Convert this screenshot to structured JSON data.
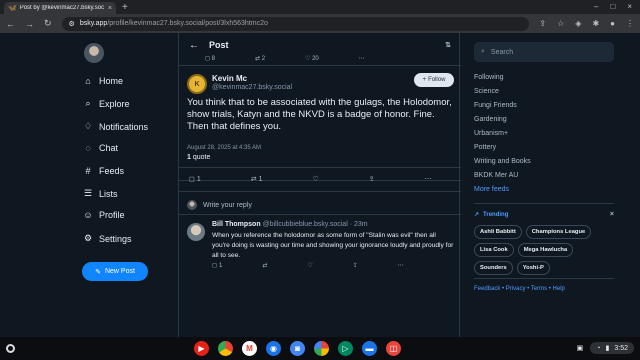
{
  "browser": {
    "tab_title": "Post by @kevinmac27.bsky.soc",
    "url_prefix": "bsky.app",
    "url_path": "/profile/kevinmac27.bsky.social/post/3lxh563htmc2o"
  },
  "nav": {
    "items": [
      {
        "label": "Home",
        "icon": "home-icon"
      },
      {
        "label": "Explore",
        "icon": "search-icon"
      },
      {
        "label": "Notifications",
        "icon": "bell-icon"
      },
      {
        "label": "Chat",
        "icon": "chat-icon"
      },
      {
        "label": "Feeds",
        "icon": "hash-icon"
      },
      {
        "label": "Lists",
        "icon": "list-icon"
      },
      {
        "label": "Profile",
        "icon": "user-icon"
      },
      {
        "label": "Settings",
        "icon": "gear-icon"
      }
    ],
    "new_post_label": "New Post"
  },
  "header": {
    "title": "Post"
  },
  "prev_post_counts": {
    "replies": "8",
    "reposts": "2",
    "likes": "20"
  },
  "post": {
    "author_name": "Kevin Mc",
    "author_handle": "@kevinmac27.bsky.social",
    "follow_label": "Follow",
    "text": "You think that to be associated with the gulags, the Holodomor, show trials, Katyn and the NKVD is a badge of honor. Fine. Then that defines you.",
    "date": "August 28, 2025 at 4:35 AM",
    "quote_count": "1",
    "quote_label": "quote",
    "reply_count": "1",
    "repost_count": "1"
  },
  "reply_box": {
    "placeholder": "Write your reply"
  },
  "comment": {
    "author_name": "Bill Thompson",
    "author_handle": "@billcubbieblue.bsky.social",
    "age": "· 23m",
    "text": "When you reference the holodomor as some form of \"Stalin was evil\" then all you're doing is wasting our time and showing your ignorance loudly and proudly for all to see.",
    "reply_count": "1"
  },
  "sidebar": {
    "search_placeholder": "Search",
    "feeds": [
      "Following",
      "Science",
      "Fungi Friends",
      "Gardening",
      "Urbanism+",
      "Pottery",
      "Writing and Books",
      "BKDK Mer AU"
    ],
    "more_feeds_label": "More feeds",
    "trending_label": "Trending",
    "trending": [
      "Ashli Babbitt",
      "Champions League",
      "Lisa Cook",
      "Mega Hawlucha",
      "Sounders",
      "Yoshi-P"
    ],
    "footer": "Feedback • Privacy • Terms • Help"
  },
  "system": {
    "time": "3:52"
  },
  "colors": {
    "accent": "#1185fe",
    "background": "#0f1720",
    "divider": "#2a3744"
  }
}
